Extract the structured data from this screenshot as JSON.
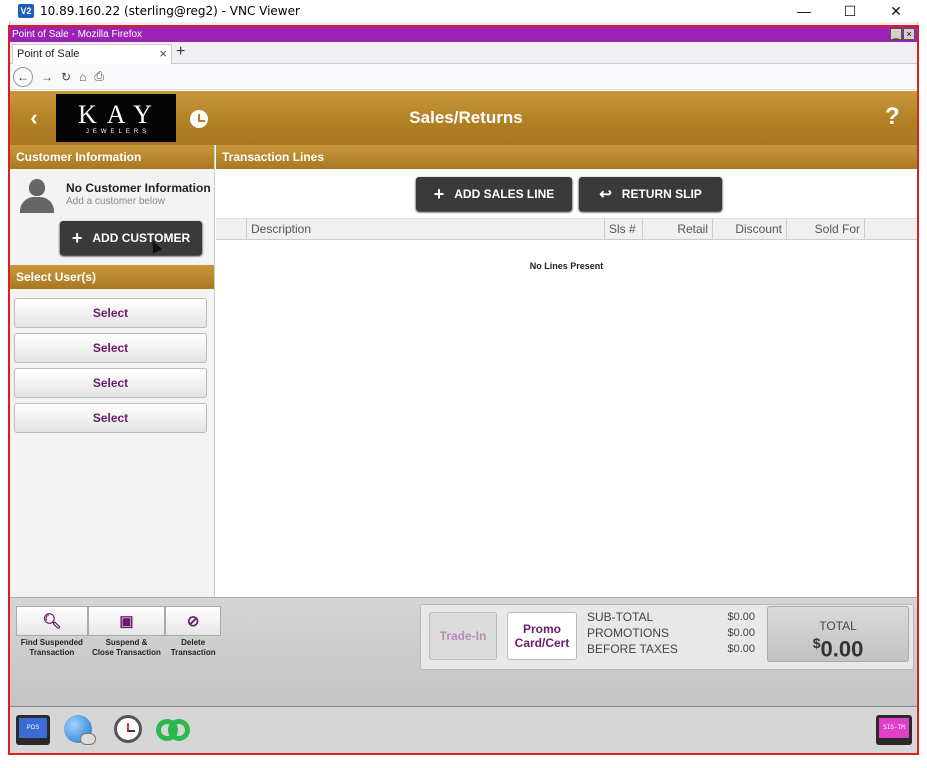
{
  "vnc": {
    "icon_text": "V2",
    "title": "10.89.160.22 (sterling@reg2) - VNC Viewer",
    "minimize": "—",
    "maximize": "☐",
    "close": "✕"
  },
  "firefox": {
    "window_title": "Point of Sale - Mozilla Firefox",
    "tab_title": "Point of Sale",
    "tab_close": "×",
    "new_tab": "+"
  },
  "header": {
    "back": "‹",
    "logo_main": "KAY",
    "logo_sub": "JEWELERS",
    "title": "Sales/Returns",
    "help": "?"
  },
  "customer": {
    "section_title": "Customer Information",
    "name": "No Customer Information",
    "hint": "Add a customer below",
    "add_button": "ADD CUSTOMER"
  },
  "users": {
    "section_title": "Select User(s)",
    "buttons": [
      "Select",
      "Select",
      "Select",
      "Select"
    ]
  },
  "transactions": {
    "section_title": "Transaction Lines",
    "add_sales_line": "ADD SALES LINE",
    "return_slip": "RETURN SLIP",
    "columns": [
      "Description",
      "Sls #",
      "Retail",
      "Discount",
      "Sold For"
    ],
    "empty_message": "No Lines Present"
  },
  "footer": {
    "actions": [
      {
        "label_1": "Find Suspended",
        "label_2": "Transaction",
        "icon": "search-icon"
      },
      {
        "label_1": "Suspend &",
        "label_2": "Close Transaction",
        "icon": "save-icon"
      },
      {
        "label_1": "Delete",
        "label_2": "Transaction",
        "icon": "delete-icon"
      }
    ],
    "trade_in": "Trade-In",
    "promo_1": "Promo",
    "promo_2": "Card/Cert",
    "subtotal_label": "SUB-TOTAL",
    "subtotal_value": "$0.00",
    "promotions_label": "PROMOTIONS",
    "promotions_value": "$0.00",
    "before_taxes_label": "BEFORE TAXES",
    "before_taxes_value": "$0.00",
    "total_label": "TOTAL",
    "total_currency": "$",
    "total_value": "0.00"
  },
  "launcher": {
    "pos_label": "POS",
    "sis_label": "SIS-TM"
  },
  "colors": {
    "gold": "#b07f22",
    "purple_text": "#6a1b6d",
    "firefox_title": "#9b22b4",
    "window_border": "#d9201f"
  }
}
